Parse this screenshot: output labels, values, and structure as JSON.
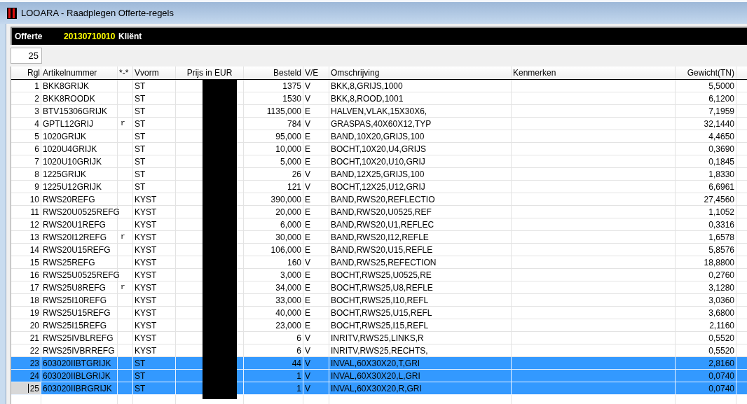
{
  "window": {
    "title": "LOOARA - Raadplegen Offerte-regels"
  },
  "header": {
    "offerte_label": "Offerte",
    "offerte_number": "20130710010",
    "client_label": "Kliënt"
  },
  "row_count_field": {
    "value": "25"
  },
  "table": {
    "columns": [
      "Rgl",
      "Artikelnummer",
      "*-*",
      "Vvorm",
      "Prijs in EUR",
      "Besteld",
      "V/E",
      "Omschrijving",
      "Kenmerken",
      "Gewicht(TN)"
    ],
    "rows": [
      {
        "rgl": "1",
        "artikel": "BKK8GRIJK",
        "mark": "",
        "vorm": "ST",
        "besteld": "1375",
        "ve": "V",
        "omschrijving": "BKK,8,GRIJS,1000",
        "gewicht": "5,5000",
        "selected": false,
        "focused": false
      },
      {
        "rgl": "2",
        "artikel": "BKK8ROODK",
        "mark": "",
        "vorm": "ST",
        "besteld": "1530",
        "ve": "V",
        "omschrijving": "BKK,8,ROOD,1001",
        "gewicht": "6,1200",
        "selected": false,
        "focused": false
      },
      {
        "rgl": "3",
        "artikel": "BTV15306GRIJK",
        "mark": "",
        "vorm": "ST",
        "besteld": "1135,000",
        "ve": "E",
        "omschrijving": "HALVEN,VLAK,15X30X6,",
        "gewicht": "7,1959",
        "selected": false,
        "focused": false
      },
      {
        "rgl": "4",
        "artikel": "GPTL12GRIJ",
        "mark": "r",
        "vorm": "ST",
        "besteld": "784",
        "ve": "V",
        "omschrijving": "GRASPAS,40X60X12,TYP",
        "gewicht": "32,1440",
        "selected": false,
        "focused": false
      },
      {
        "rgl": "5",
        "artikel": "1020GRIJK",
        "mark": "",
        "vorm": "ST",
        "besteld": "95,000",
        "ve": "E",
        "omschrijving": "BAND,10X20,GRIJS,100",
        "gewicht": "4,4650",
        "selected": false,
        "focused": false
      },
      {
        "rgl": "6",
        "artikel": "1020U4GRIJK",
        "mark": "",
        "vorm": "ST",
        "besteld": "10,000",
        "ve": "E",
        "omschrijving": "BOCHT,10X20,U4,GRIJS",
        "gewicht": "0,3690",
        "selected": false,
        "focused": false
      },
      {
        "rgl": "7",
        "artikel": "1020U10GRIJK",
        "mark": "",
        "vorm": "ST",
        "besteld": "5,000",
        "ve": "E",
        "omschrijving": "BOCHT,10X20,U10,GRIJ",
        "gewicht": "0,1845",
        "selected": false,
        "focused": false
      },
      {
        "rgl": "8",
        "artikel": "1225GRIJK",
        "mark": "",
        "vorm": "ST",
        "besteld": "26",
        "ve": "V",
        "omschrijving": "BAND,12X25,GRIJS,100",
        "gewicht": "1,8330",
        "selected": false,
        "focused": false
      },
      {
        "rgl": "9",
        "artikel": "1225U12GRIJK",
        "mark": "",
        "vorm": "ST",
        "besteld": "121",
        "ve": "V",
        "omschrijving": "BOCHT,12X25,U12,GRIJ",
        "gewicht": "6,6961",
        "selected": false,
        "focused": false
      },
      {
        "rgl": "10",
        "artikel": "RWS20REFG",
        "mark": "",
        "vorm": "KYST",
        "besteld": "390,000",
        "ve": "E",
        "omschrijving": "BAND,RWS20,REFLECTIO",
        "gewicht": "27,4560",
        "selected": false,
        "focused": false
      },
      {
        "rgl": "11",
        "artikel": "RWS20U0525REFG",
        "mark": "",
        "vorm": "KYST",
        "besteld": "20,000",
        "ve": "E",
        "omschrijving": "BAND,RWS20,U0525,REF",
        "gewicht": "1,1052",
        "selected": false,
        "focused": false
      },
      {
        "rgl": "12",
        "artikel": "RWS20U1REFG",
        "mark": "",
        "vorm": "KYST",
        "besteld": "6,000",
        "ve": "E",
        "omschrijving": "BAND,RWS20,U1,REFLEC",
        "gewicht": "0,3316",
        "selected": false,
        "focused": false
      },
      {
        "rgl": "13",
        "artikel": "RWS20I12REFG",
        "mark": "r",
        "vorm": "KYST",
        "besteld": "30,000",
        "ve": "E",
        "omschrijving": "BAND,RWS20,I12,REFLE",
        "gewicht": "1,6578",
        "selected": false,
        "focused": false
      },
      {
        "rgl": "14",
        "artikel": "RWS20U15REFG",
        "mark": "",
        "vorm": "KYST",
        "besteld": "106,000",
        "ve": "E",
        "omschrijving": "BAND,RWS20,U15,REFLE",
        "gewicht": "5,8576",
        "selected": false,
        "focused": false
      },
      {
        "rgl": "15",
        "artikel": "RWS25REFG",
        "mark": "",
        "vorm": "KYST",
        "besteld": "160",
        "ve": "V",
        "omschrijving": "BAND,RWS25,REFECTION",
        "gewicht": "18,8800",
        "selected": false,
        "focused": false
      },
      {
        "rgl": "16",
        "artikel": "RWS25U0525REFG",
        "mark": "",
        "vorm": "KYST",
        "besteld": "3,000",
        "ve": "E",
        "omschrijving": "BOCHT,RWS25,U0525,RE",
        "gewicht": "0,2760",
        "selected": false,
        "focused": false
      },
      {
        "rgl": "17",
        "artikel": "RWS25U8REFG",
        "mark": "r",
        "vorm": "KYST",
        "besteld": "34,000",
        "ve": "E",
        "omschrijving": "BOCHT,RWS25,U8,REFLE",
        "gewicht": "3,1280",
        "selected": false,
        "focused": false
      },
      {
        "rgl": "18",
        "artikel": "RWS25I10REFG",
        "mark": "",
        "vorm": "KYST",
        "besteld": "33,000",
        "ve": "E",
        "omschrijving": "BOCHT,RWS25,I10,REFL",
        "gewicht": "3,0360",
        "selected": false,
        "focused": false
      },
      {
        "rgl": "19",
        "artikel": "RWS25U15REFG",
        "mark": "",
        "vorm": "KYST",
        "besteld": "40,000",
        "ve": "E",
        "omschrijving": "BOCHT,RWS25,U15,REFL",
        "gewicht": "3,6800",
        "selected": false,
        "focused": false
      },
      {
        "rgl": "20",
        "artikel": "RWS25I15REFG",
        "mark": "",
        "vorm": "KYST",
        "besteld": "23,000",
        "ve": "E",
        "omschrijving": "BOCHT,RWS25,I15,REFL",
        "gewicht": "2,1160",
        "selected": false,
        "focused": false
      },
      {
        "rgl": "21",
        "artikel": "RWS25IVBLREFG",
        "mark": "",
        "vorm": "KYST",
        "besteld": "6",
        "ve": "V",
        "omschrijving": "INRITV,RWS25,LINKS,R",
        "gewicht": "0,5520",
        "selected": false,
        "focused": false
      },
      {
        "rgl": "22",
        "artikel": "RWS25IVBRREFG",
        "mark": "",
        "vorm": "KYST",
        "besteld": "6",
        "ve": "V",
        "omschrijving": "INRITV,RWS25,RECHTS,",
        "gewicht": "0,5520",
        "selected": false,
        "focused": false
      },
      {
        "rgl": "23",
        "artikel": "603020IIBTGRIJK",
        "mark": "",
        "vorm": "ST",
        "besteld": "44",
        "ve": "V",
        "omschrijving": "INVAL,60X30X20,T,GRI",
        "gewicht": "2,8160",
        "selected": true,
        "focused": false
      },
      {
        "rgl": "24",
        "artikel": "603020IIBLGRIJK",
        "mark": "",
        "vorm": "ST",
        "besteld": "1",
        "ve": "V",
        "omschrijving": "INVAL,60X30X20,L,GRI",
        "gewicht": "0,0740",
        "selected": true,
        "focused": false
      },
      {
        "rgl": "25",
        "artikel": "603020IIBRGRIJK",
        "mark": "",
        "vorm": "ST",
        "besteld": "1",
        "ve": "V",
        "omschrijving": "INVAL,60X30X20,R,GRI",
        "gewicht": "0,0740",
        "selected": true,
        "focused": true
      }
    ]
  }
}
